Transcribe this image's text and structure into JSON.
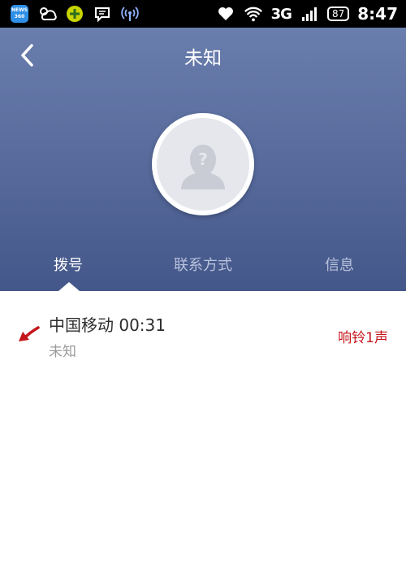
{
  "status_bar": {
    "news_icon_text_1": "NEWS",
    "news_icon_text_2": "360",
    "network": "3G",
    "battery": "87",
    "time": "8:47",
    "icons": [
      "news-app-icon",
      "weather-icon",
      "plus-app-icon",
      "message-icon",
      "hotspot-icon",
      "heart-icon",
      "wifi-icon",
      "signal-icon",
      "battery-icon"
    ]
  },
  "header": {
    "title": "未知",
    "back_icon": "chevron-left-icon",
    "avatar_icon": "unknown-person-icon"
  },
  "tabs": [
    {
      "label": "拨号",
      "active": true
    },
    {
      "label": "联系方式",
      "active": false
    },
    {
      "label": "信息",
      "active": false
    }
  ],
  "call_log": [
    {
      "carrier_duration": "中国移动 00:31",
      "subtitle": "未知",
      "status": "响铃1声",
      "direction_icon": "missed-call-arrow-icon"
    }
  ],
  "colors": {
    "header_top": "#6a7eae",
    "header_bottom": "#44578a",
    "status_red": "#c4161c"
  }
}
